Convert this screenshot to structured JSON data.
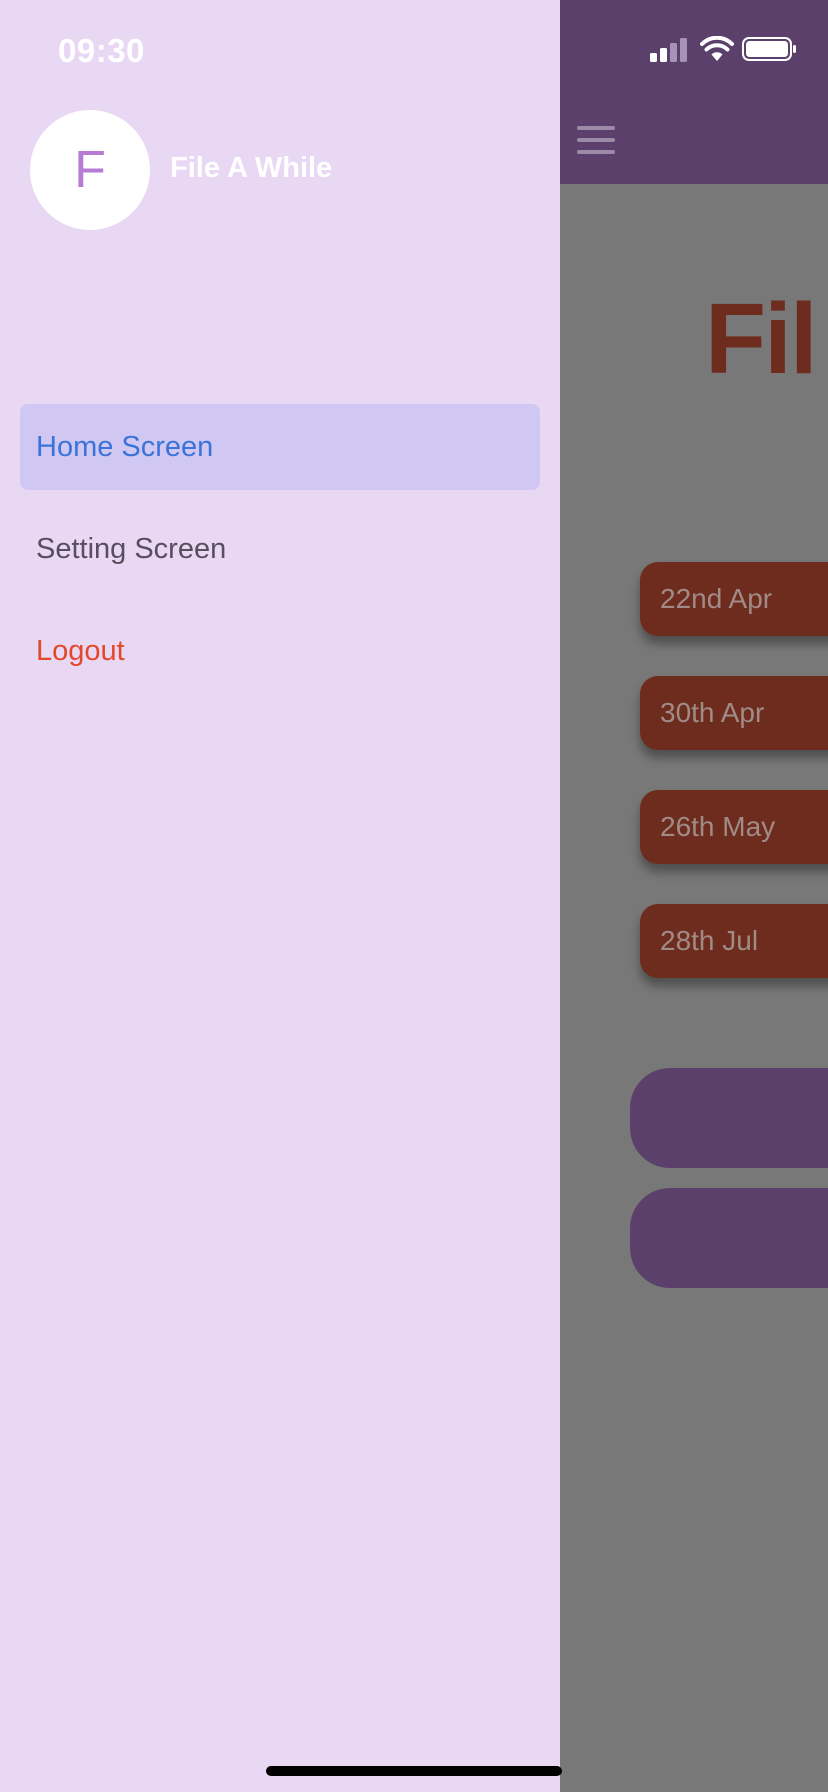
{
  "status_bar": {
    "time": "09:30",
    "signal_icon": "cellular-signal-icon",
    "wifi_icon": "wifi-icon",
    "battery_icon": "battery-icon"
  },
  "drawer": {
    "avatar_initial": "F",
    "app_name": "File A While",
    "items": [
      {
        "label": "Home Screen",
        "selected": true
      },
      {
        "label": "Setting Screen",
        "selected": false
      },
      {
        "label": "Logout",
        "selected": false
      }
    ],
    "colors": {
      "background": "#e8d8f3",
      "selected_background": "#d0c8f2",
      "selected_text": "#3a73d9",
      "logout_text": "#e3482b"
    }
  },
  "main": {
    "menu_icon": "hamburger-menu-icon",
    "title_visible": "Fil",
    "dates": [
      "22nd Apr",
      "30th Apr",
      "26th May",
      "28th Jul"
    ],
    "colors": {
      "app_bar": "#5b406c",
      "date_card": "#6e2c1e",
      "scrim": "#787878"
    }
  }
}
